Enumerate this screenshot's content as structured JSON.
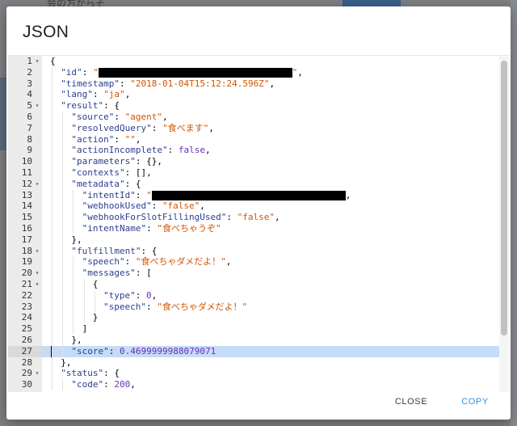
{
  "background": {
    "top_text": "会の方からそ"
  },
  "dialog": {
    "title": "JSON",
    "close_label": "CLOSE",
    "copy_label": "COPY",
    "accent_color": "#3a8ee6"
  },
  "editor": {
    "active_line": 27,
    "lines": [
      {
        "n": "1",
        "fold": true,
        "indent": 0,
        "tokens": [
          {
            "t": "p",
            "v": "{"
          }
        ]
      },
      {
        "n": "2",
        "indent": 1,
        "tokens": [
          {
            "t": "k",
            "v": "\"id\""
          },
          {
            "t": "p",
            "v": ": "
          },
          {
            "t": "s",
            "v": "\""
          },
          {
            "t": "redact",
            "w": 240
          },
          {
            "t": "s",
            "v": "\""
          },
          {
            "t": "p",
            "v": ","
          }
        ]
      },
      {
        "n": "3",
        "indent": 1,
        "tokens": [
          {
            "t": "k",
            "v": "\"timestamp\""
          },
          {
            "t": "p",
            "v": ": "
          },
          {
            "t": "s",
            "v": "\"2018-01-04T15:12:24.596Z\""
          },
          {
            "t": "p",
            "v": ","
          }
        ]
      },
      {
        "n": "4",
        "indent": 1,
        "tokens": [
          {
            "t": "k",
            "v": "\"lang\""
          },
          {
            "t": "p",
            "v": ": "
          },
          {
            "t": "s",
            "v": "\"ja\""
          },
          {
            "t": "p",
            "v": ","
          }
        ]
      },
      {
        "n": "5",
        "fold": true,
        "indent": 1,
        "tokens": [
          {
            "t": "k",
            "v": "\"result\""
          },
          {
            "t": "p",
            "v": ": {"
          }
        ]
      },
      {
        "n": "6",
        "indent": 2,
        "tokens": [
          {
            "t": "k",
            "v": "\"source\""
          },
          {
            "t": "p",
            "v": ": "
          },
          {
            "t": "s",
            "v": "\"agent\""
          },
          {
            "t": "p",
            "v": ","
          }
        ]
      },
      {
        "n": "7",
        "indent": 2,
        "tokens": [
          {
            "t": "k",
            "v": "\"resolvedQuery\""
          },
          {
            "t": "p",
            "v": ": "
          },
          {
            "t": "s",
            "v": "\"食べます\""
          },
          {
            "t": "p",
            "v": ","
          }
        ]
      },
      {
        "n": "8",
        "indent": 2,
        "tokens": [
          {
            "t": "k",
            "v": "\"action\""
          },
          {
            "t": "p",
            "v": ": "
          },
          {
            "t": "s",
            "v": "\"\""
          },
          {
            "t": "p",
            "v": ","
          }
        ]
      },
      {
        "n": "9",
        "indent": 2,
        "tokens": [
          {
            "t": "k",
            "v": "\"actionIncomplete\""
          },
          {
            "t": "p",
            "v": ": "
          },
          {
            "t": "b",
            "v": "false"
          },
          {
            "t": "p",
            "v": ","
          }
        ]
      },
      {
        "n": "10",
        "indent": 2,
        "tokens": [
          {
            "t": "k",
            "v": "\"parameters\""
          },
          {
            "t": "p",
            "v": ": {},"
          }
        ]
      },
      {
        "n": "11",
        "indent": 2,
        "tokens": [
          {
            "t": "k",
            "v": "\"contexts\""
          },
          {
            "t": "p",
            "v": ": [],"
          }
        ]
      },
      {
        "n": "12",
        "fold": true,
        "indent": 2,
        "tokens": [
          {
            "t": "k",
            "v": "\"metadata\""
          },
          {
            "t": "p",
            "v": ": {"
          }
        ]
      },
      {
        "n": "13",
        "indent": 3,
        "tokens": [
          {
            "t": "k",
            "v": "\"intentId\""
          },
          {
            "t": "p",
            "v": ": "
          },
          {
            "t": "s",
            "v": "\""
          },
          {
            "t": "redact",
            "w": 240
          },
          {
            "t": "p",
            "v": ","
          }
        ]
      },
      {
        "n": "14",
        "indent": 3,
        "tokens": [
          {
            "t": "k",
            "v": "\"webhookUsed\""
          },
          {
            "t": "p",
            "v": ": "
          },
          {
            "t": "s",
            "v": "\"false\""
          },
          {
            "t": "p",
            "v": ","
          }
        ]
      },
      {
        "n": "15",
        "indent": 3,
        "tokens": [
          {
            "t": "k",
            "v": "\"webhookForSlotFillingUsed\""
          },
          {
            "t": "p",
            "v": ": "
          },
          {
            "t": "s",
            "v": "\"false\""
          },
          {
            "t": "p",
            "v": ","
          }
        ]
      },
      {
        "n": "16",
        "indent": 3,
        "tokens": [
          {
            "t": "k",
            "v": "\"intentName\""
          },
          {
            "t": "p",
            "v": ": "
          },
          {
            "t": "s",
            "v": "\"食べちゃうぞ\""
          }
        ]
      },
      {
        "n": "17",
        "indent": 2,
        "tokens": [
          {
            "t": "p",
            "v": "},"
          }
        ]
      },
      {
        "n": "18",
        "fold": true,
        "indent": 2,
        "tokens": [
          {
            "t": "k",
            "v": "\"fulfillment\""
          },
          {
            "t": "p",
            "v": ": {"
          }
        ]
      },
      {
        "n": "19",
        "indent": 3,
        "tokens": [
          {
            "t": "k",
            "v": "\"speech\""
          },
          {
            "t": "p",
            "v": ": "
          },
          {
            "t": "s",
            "v": "\"食べちゃダメだよ！\""
          },
          {
            "t": "p",
            "v": ","
          }
        ]
      },
      {
        "n": "20",
        "fold": true,
        "indent": 3,
        "tokens": [
          {
            "t": "k",
            "v": "\"messages\""
          },
          {
            "t": "p",
            "v": ": ["
          }
        ]
      },
      {
        "n": "21",
        "fold": true,
        "indent": 4,
        "tokens": [
          {
            "t": "p",
            "v": "{"
          }
        ]
      },
      {
        "n": "22",
        "indent": 5,
        "tokens": [
          {
            "t": "k",
            "v": "\"type\""
          },
          {
            "t": "p",
            "v": ": "
          },
          {
            "t": "n",
            "v": "0"
          },
          {
            "t": "p",
            "v": ","
          }
        ]
      },
      {
        "n": "23",
        "indent": 5,
        "tokens": [
          {
            "t": "k",
            "v": "\"speech\""
          },
          {
            "t": "p",
            "v": ": "
          },
          {
            "t": "s",
            "v": "\"食べちゃダメだよ！\""
          }
        ]
      },
      {
        "n": "24",
        "indent": 4,
        "tokens": [
          {
            "t": "p",
            "v": "}"
          }
        ]
      },
      {
        "n": "25",
        "indent": 3,
        "tokens": [
          {
            "t": "p",
            "v": "]"
          }
        ]
      },
      {
        "n": "26",
        "indent": 2,
        "tokens": [
          {
            "t": "p",
            "v": "},"
          }
        ]
      },
      {
        "n": "27",
        "indent": 2,
        "tokens": [
          {
            "t": "k",
            "v": "\"score\""
          },
          {
            "t": "p",
            "v": ": "
          },
          {
            "t": "n",
            "v": "0.4699999988079071"
          }
        ]
      },
      {
        "n": "28",
        "indent": 1,
        "tokens": [
          {
            "t": "p",
            "v": "},"
          }
        ]
      },
      {
        "n": "29",
        "fold": true,
        "indent": 1,
        "tokens": [
          {
            "t": "k",
            "v": "\"status\""
          },
          {
            "t": "p",
            "v": ": {"
          }
        ]
      },
      {
        "n": "30",
        "indent": 2,
        "tokens": [
          {
            "t": "k",
            "v": "\"code\""
          },
          {
            "t": "p",
            "v": ": "
          },
          {
            "t": "n",
            "v": "200"
          },
          {
            "t": "p",
            "v": ","
          }
        ]
      }
    ]
  }
}
